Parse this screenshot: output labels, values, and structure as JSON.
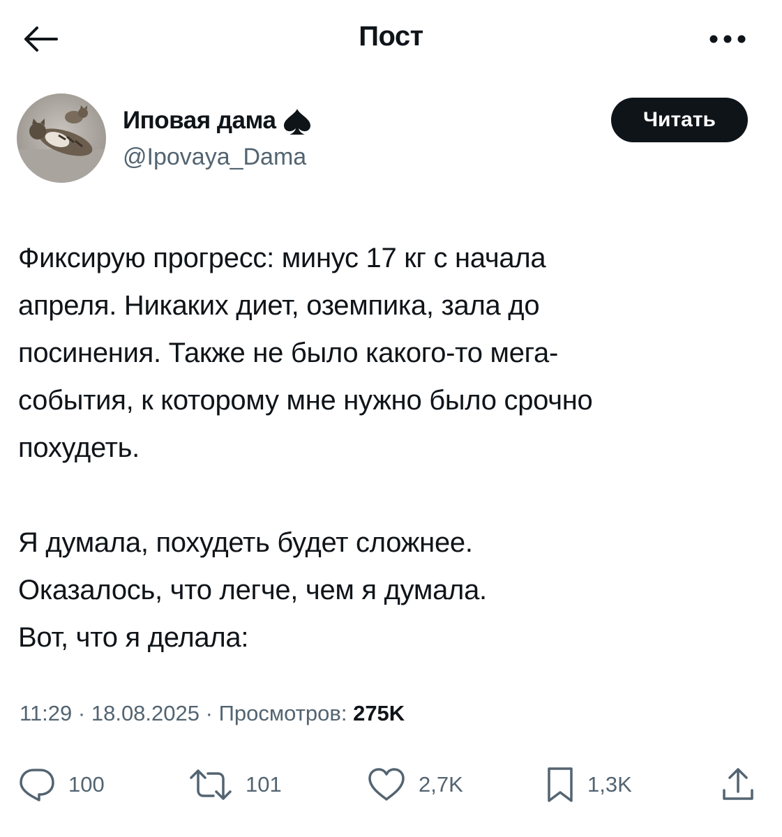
{
  "header": {
    "title": "Пост",
    "back_icon": "arrow-left-icon",
    "more_icon": "more-dots-icon"
  },
  "author": {
    "name": "Иповая дама",
    "badge_icon": "spade-icon",
    "handle": "@Ipovaya_Dama",
    "follow_label": "Читать"
  },
  "post": {
    "paragraph1": [
      "Фиксирую прогресс: минус 17 кг с начала",
      "апреля. Никаких диет, оземпика, зала до",
      "посинения. Также не было какого-то мега-",
      "события, к которому мне нужно было срочно",
      "похудеть."
    ],
    "paragraph2": [
      "Я думала, похудеть будет сложнее.",
      "Оказалось, что легче, чем я думала.",
      "Вот, что я делала:"
    ]
  },
  "meta": {
    "time": "11:29",
    "separator": " · ",
    "date": "18.08.2025",
    "views_label": "Просмотров: ",
    "views_value": "275K"
  },
  "actions": {
    "reply": {
      "icon": "reply-icon",
      "count": "100"
    },
    "repost": {
      "icon": "repost-icon",
      "count": "101"
    },
    "like": {
      "icon": "heart-icon",
      "count": "2,7K"
    },
    "bookmark": {
      "icon": "bookmark-icon",
      "count": "1,3K"
    },
    "share": {
      "icon": "share-icon"
    }
  },
  "colors": {
    "text": "#0f1419",
    "secondary": "#536471",
    "button_bg": "#0f1419",
    "button_text": "#ffffff"
  }
}
